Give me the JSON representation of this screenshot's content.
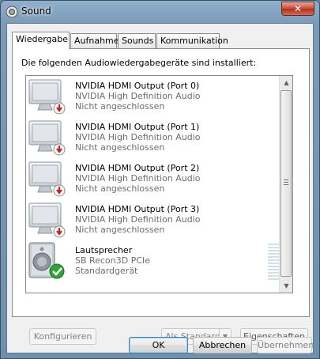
{
  "window": {
    "title": "Sound",
    "close_label": "✕"
  },
  "tabs": [
    {
      "label": "Wiedergabe",
      "active": true
    },
    {
      "label": "Aufnahme",
      "active": false
    },
    {
      "label": "Sounds",
      "active": false
    },
    {
      "label": "Kommunikation",
      "active": false
    }
  ],
  "intro": "Die folgenden Audiowiedergabegeräte sind installiert:",
  "devices": [
    {
      "name": "NVIDIA HDMI Output (Port 0)",
      "driver": "NVIDIA High Definition Audio",
      "status": "Nicht angeschlossen",
      "icon": "monitor-icon",
      "badge": "unplugged-badge"
    },
    {
      "name": "NVIDIA HDMI Output (Port 1)",
      "driver": "NVIDIA High Definition Audio",
      "status": "Nicht angeschlossen",
      "icon": "monitor-icon",
      "badge": "unplugged-badge"
    },
    {
      "name": "NVIDIA HDMI Output (Port 2)",
      "driver": "NVIDIA High Definition Audio",
      "status": "Nicht angeschlossen",
      "icon": "monitor-icon",
      "badge": "unplugged-badge"
    },
    {
      "name": "NVIDIA HDMI Output (Port 3)",
      "driver": "NVIDIA High Definition Audio",
      "status": "Nicht angeschlossen",
      "icon": "monitor-icon",
      "badge": "unplugged-badge"
    },
    {
      "name": "Lautsprecher",
      "driver": "SB Recon3D PCIe",
      "status": "Standardgerät",
      "icon": "speaker-icon",
      "badge": "default-check-badge"
    }
  ],
  "buttons": {
    "configure": "Konfigurieren",
    "set_default": "Als Standard",
    "properties": "Eigenschaften",
    "ok": "OK",
    "cancel": "Abbrechen",
    "apply": "Übernehmen"
  },
  "colors": {
    "unplugged_badge": "#c8231b",
    "default_badge": "#2ea336"
  }
}
